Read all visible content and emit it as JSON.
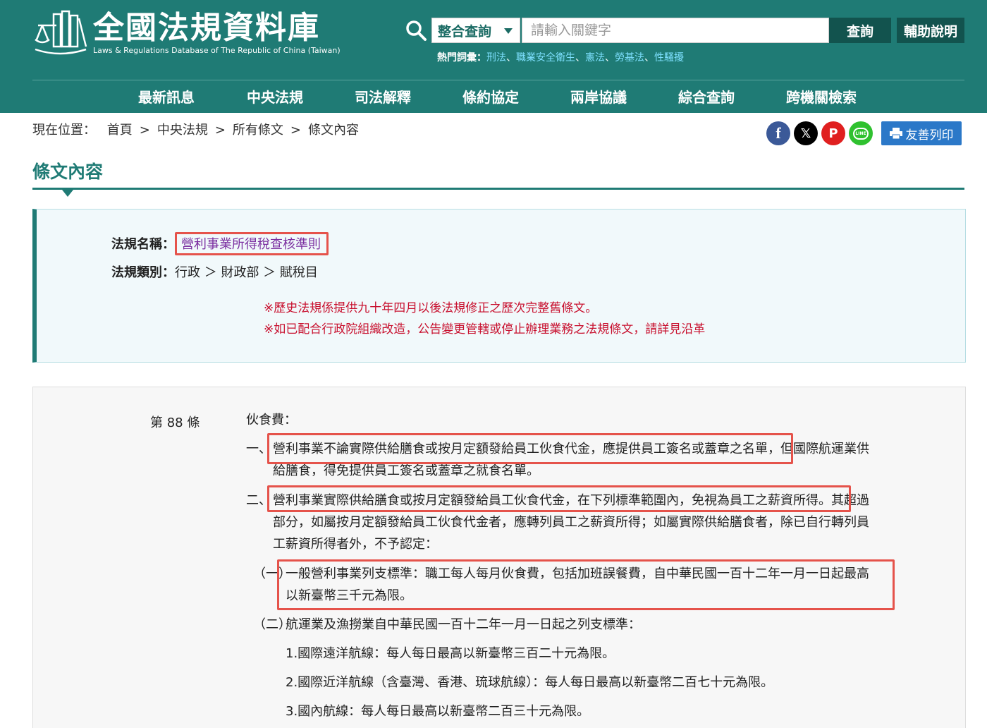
{
  "header": {
    "title": "全國法規資料庫",
    "subtitle": "Laws & Regulations Database of The Republic of China (Taiwan)",
    "search": {
      "mode": "整合查詢",
      "placeholder": "請輸入關鍵字",
      "query_button": "查詢",
      "help_button": "輔助說明"
    },
    "hot_terms": {
      "label": "熱門詞彙：",
      "terms": [
        "刑法",
        "職業安全衛生",
        "憲法",
        "勞基法",
        "性騷擾"
      ]
    },
    "nav": [
      "最新訊息",
      "中央法規",
      "司法解釋",
      "條約協定",
      "兩岸協議",
      "綜合查詢",
      "跨機關檢索"
    ],
    "brand_color": "#1f7b75"
  },
  "breadcrumb": {
    "label": "現在位置：",
    "items": [
      "首頁",
      "中央法規",
      "所有條文",
      "條文內容"
    ],
    "separator": ">"
  },
  "share": {
    "facebook": "f",
    "x": "𝕏",
    "plurk": "P",
    "line": "LINE",
    "print_label": "友善列印"
  },
  "page_title": "條文內容",
  "law_info": {
    "name_label": "法規名稱：",
    "name": "營利事業所得稅查核準則",
    "category_label": "法規類別：",
    "category": "行政 ＞ 財政部 ＞ 賦稅目",
    "notice_1": "※歷史法規係提供九十年四月以後法規修正之歷次完整舊條文。",
    "notice_2": "※如已配合行政院組織改造，公告變更管轄或停止辦理業務之法規條文，請詳見沿革"
  },
  "article": {
    "number": "第 88 條",
    "heading": "伙食費：",
    "p1_prefix": "一、",
    "p1_line1": "營利事業不論實際供給膳食或按月定額發給員工伙食代金，應提供員工簽名或蓋章之名單，但國際航運業供",
    "p1_line2": "給膳食，得免提供員工簽名或蓋章之就食名單。",
    "p2_prefix": "二、",
    "p2_line1": "營利事業實際供給膳食或按月定額發給員工伙食代金，在下列標準範圍內，免視為員工之薪資所得。其超過",
    "p2_line2": "部分，如屬按月定額發給員工伙食代金者，應轉列員工之薪資所得；如屬實際供給膳食者，除已自行轉列員",
    "p2_line3": "工薪資所得者外，不予認定：",
    "s1_prefix": "（一）",
    "s1_line1": "一般營利事業列支標準：職工每人每月伙食費，包括加班誤餐費，自中華民國一百十二年一月一日起最高",
    "s1_line2": "以新臺幣三千元為限。",
    "s2_prefix": "（二）",
    "s2_line1": "航運業及漁撈業自中華民國一百十二年一月一日起之列支標準：",
    "i1": "1.國際遠洋航線：每人每日最高以新臺幣三百二十元為限。",
    "i2": "2.國際近洋航線（含臺灣、香港、琉球航線）：每人每日最高以新臺幣二百七十元為限。",
    "i3": "3.國內航線：每人每日最高以新臺幣二百三十元為限。"
  },
  "highlight_color": "#e5534b"
}
